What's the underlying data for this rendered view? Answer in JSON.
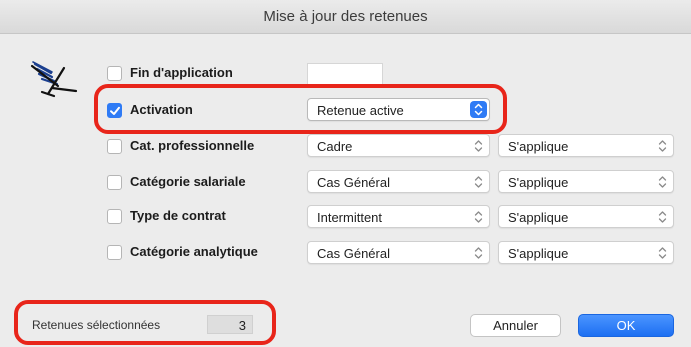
{
  "window": {
    "title": "Mise à jour des retenues"
  },
  "rows": [
    {
      "label": "Fin d'application",
      "checked": false
    },
    {
      "label": "Activation",
      "checked": true,
      "select": "Retenue active"
    },
    {
      "label": "Cat. professionnelle",
      "checked": false,
      "select": "Cadre",
      "applies": "S'applique"
    },
    {
      "label": "Catégorie salariale",
      "checked": false,
      "select": "Cas Général",
      "applies": "S'applique"
    },
    {
      "label": "Type de contrat",
      "checked": false,
      "select": "Intermittent",
      "applies": "S'applique"
    },
    {
      "label": "Catégorie analytique",
      "checked": false,
      "select": "Cas Général",
      "applies": "S'applique"
    }
  ],
  "fin_application_value": "",
  "footer": {
    "selected_label": "Retenues sélectionnées",
    "selected_count": "3",
    "cancel_label": "Annuler",
    "ok_label": "OK"
  },
  "colors": {
    "accent": "#2f7bf5",
    "highlight": "#e8251a"
  }
}
